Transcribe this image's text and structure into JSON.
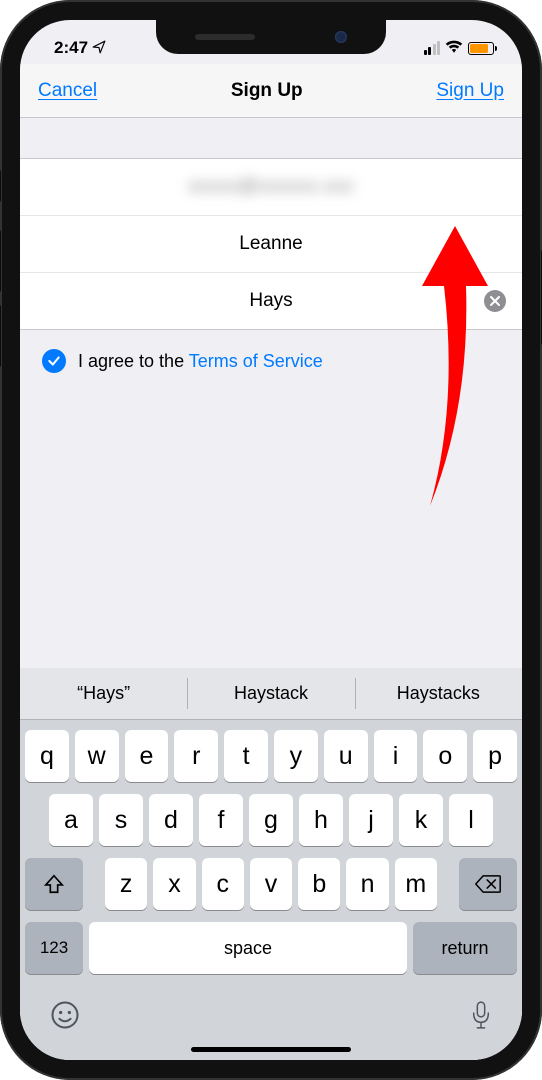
{
  "status": {
    "time": "2:47",
    "location_icon": "➤"
  },
  "nav": {
    "cancel": "Cancel",
    "title": "Sign Up",
    "signup": "Sign Up"
  },
  "form": {
    "email_masked": "xxxxx@xxxxxx.xxx",
    "first_name": "Leanne",
    "last_name": "Hays"
  },
  "terms": {
    "prefix": "I agree to the ",
    "link": "Terms of Service"
  },
  "suggestions": [
    "“Hays”",
    "Haystack",
    "Haystacks"
  ],
  "keys": {
    "row1": [
      "q",
      "w",
      "e",
      "r",
      "t",
      "y",
      "u",
      "i",
      "o",
      "p"
    ],
    "row2": [
      "a",
      "s",
      "d",
      "f",
      "g",
      "h",
      "j",
      "k",
      "l"
    ],
    "row3": [
      "z",
      "x",
      "c",
      "v",
      "b",
      "n",
      "m"
    ],
    "shift": "⇧",
    "backspace": "⌫",
    "numbers": "123",
    "space": "space",
    "return": "return",
    "emoji": "☺",
    "mic": "🎤"
  }
}
